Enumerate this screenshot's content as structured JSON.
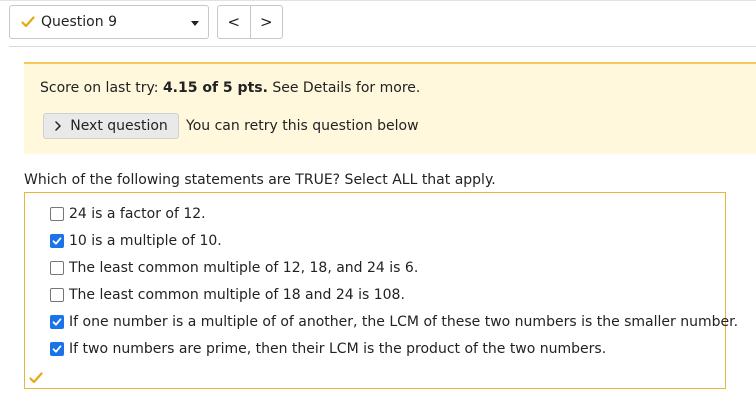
{
  "header": {
    "question_selector": "Question 9",
    "prev_label": "<",
    "next_label": ">"
  },
  "banner": {
    "score_prefix": "Score on last try: ",
    "score_value": "4.15 of 5 pts.",
    "score_suffix": " See Details for more.",
    "next_question_label": "Next question",
    "retry_text": "You can retry this question below"
  },
  "question": {
    "prompt": "Which of the following statements are TRUE? Select ALL that apply.",
    "options": [
      {
        "label": "24 is a factor of 12.",
        "checked": false
      },
      {
        "label": "10 is a multiple of 10.",
        "checked": true
      },
      {
        "label": "The least common multiple of 12, 18, and 24 is 6.",
        "checked": false
      },
      {
        "label": "The least common multiple of 18 and 24 is 108.",
        "checked": false
      },
      {
        "label": "If one number is a multiple of of another, the LCM of these two numbers is the smaller number.",
        "checked": true
      },
      {
        "label": "If two numbers are prime, then their LCM is the product of the two numbers.",
        "checked": true
      }
    ]
  },
  "colors": {
    "accent": "#1a73e8",
    "banner_bg": "#fff8dc",
    "banner_border": "#f5c95a",
    "box_border": "#e8b63a",
    "check_gold": "#e6a817"
  },
  "icons": [
    "check-icon",
    "chevron-down-icon",
    "chevron-left-icon",
    "chevron-right-icon",
    "chevron-right-small-icon"
  ]
}
